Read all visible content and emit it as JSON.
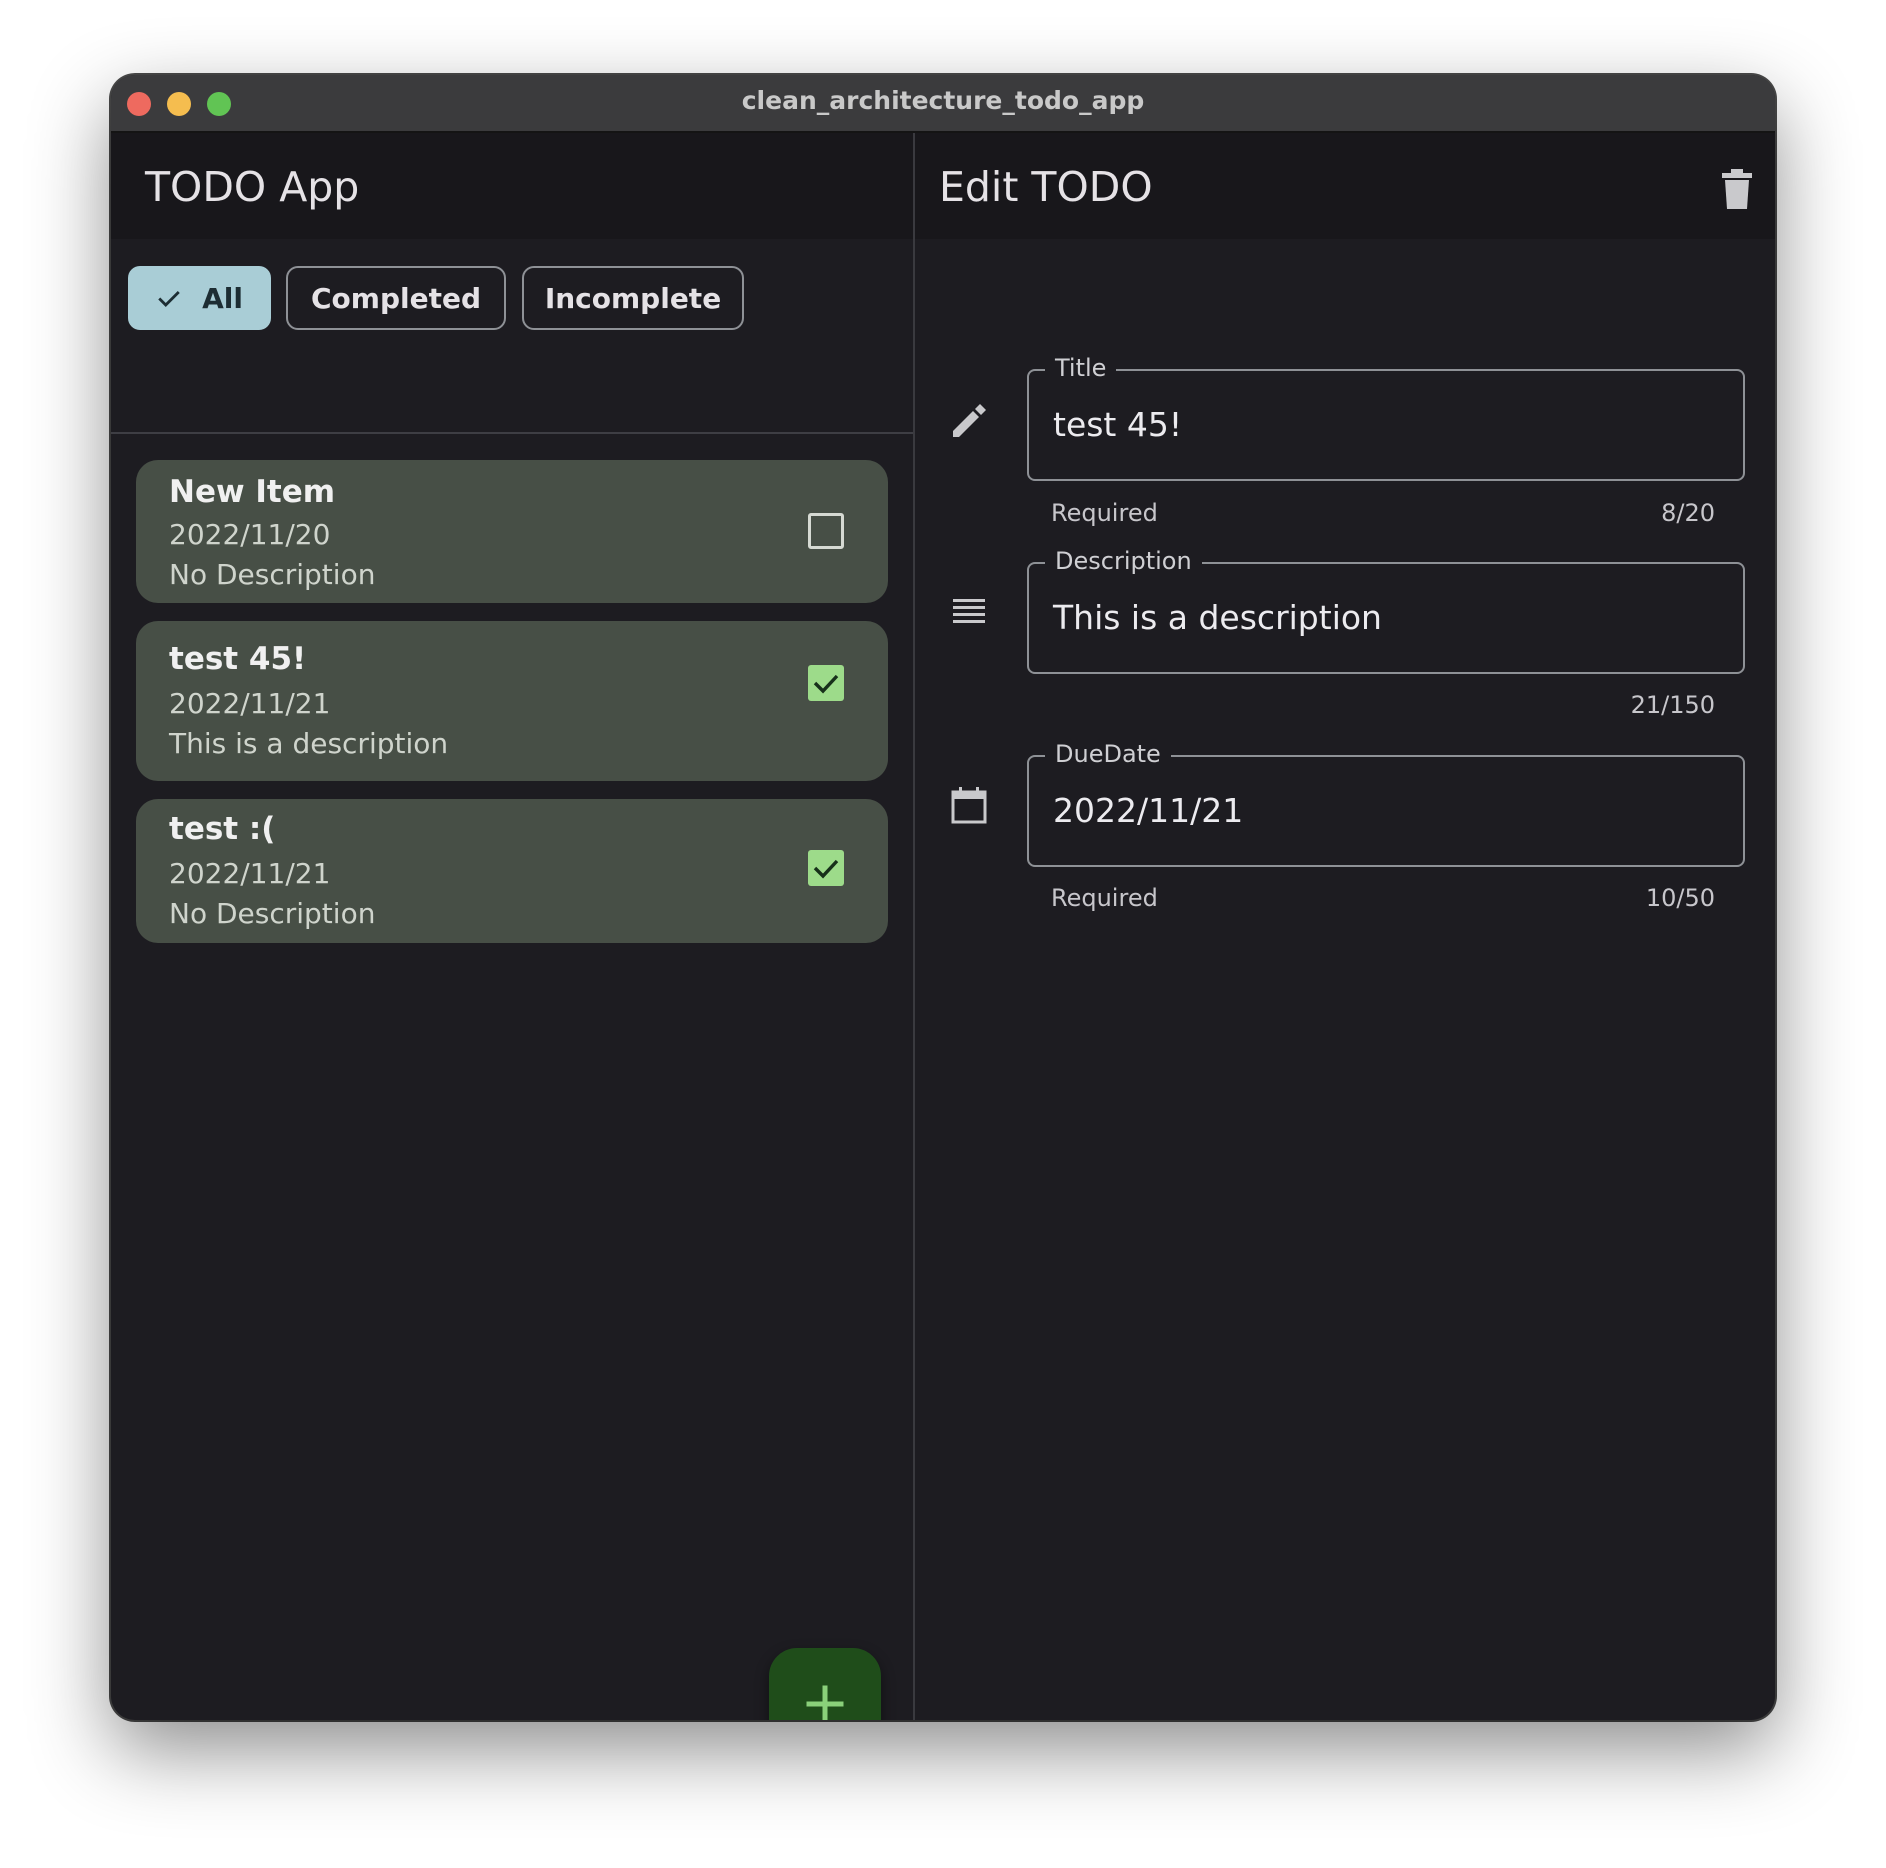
{
  "window": {
    "title": "clean_architecture_todo_app"
  },
  "list_pane": {
    "title": "TODO App",
    "filters": [
      {
        "label": "All",
        "selected": true
      },
      {
        "label": "Completed",
        "selected": false
      },
      {
        "label": "Incomplete",
        "selected": false
      }
    ],
    "items": [
      {
        "title": "New Item",
        "date": "2022/11/20",
        "description": "No Description",
        "completed": false
      },
      {
        "title": "test 45!",
        "date": "2022/11/21",
        "description": "This is a description",
        "completed": true
      },
      {
        "title": "test :(",
        "date": "2022/11/21",
        "description": "No Description",
        "completed": true
      }
    ],
    "fab_icon": "plus-icon"
  },
  "edit_pane": {
    "title": "Edit TODO",
    "delete_icon": "trash-icon",
    "fields": {
      "title": {
        "label": "Title",
        "value": "test 45!",
        "helper": "Required",
        "counter": "8/20",
        "icon": "pencil-icon"
      },
      "description": {
        "label": "Description",
        "value": "This is a description",
        "helper": "",
        "counter": "21/150",
        "icon": "notes-icon"
      },
      "due_date": {
        "label": "DueDate",
        "value": "2022/11/21",
        "helper": "Required",
        "counter": "10/50",
        "icon": "calendar-icon"
      }
    }
  },
  "colors": {
    "background": "#1d1c21",
    "app_bar": "#18171b",
    "card": "#474f46",
    "chip_selected": "#a9cdd6",
    "checkbox_checked": "#9ddb8a",
    "fab": "#1f4d1a",
    "fab_icon": "#8ad07a"
  }
}
